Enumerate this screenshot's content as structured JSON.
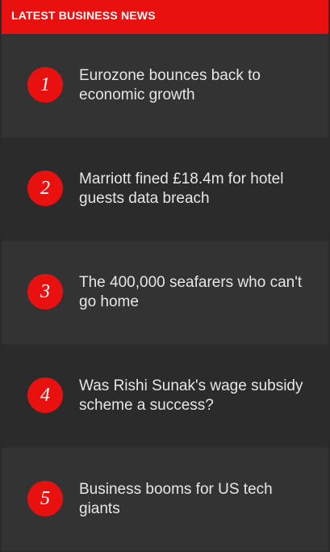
{
  "header": {
    "title": "LATEST BUSINESS NEWS"
  },
  "colors": {
    "accent": "#e8110f",
    "background_odd": "#333333",
    "background_even": "#2b2b2b",
    "text": "#e6e6e6"
  },
  "news": {
    "items": [
      {
        "rank": "1",
        "headline": "Eurozone bounces back to economic growth"
      },
      {
        "rank": "2",
        "headline": "Marriott fined £18.4m for hotel guests data breach"
      },
      {
        "rank": "3",
        "headline": "The 400,000 seafarers who can't go home"
      },
      {
        "rank": "4",
        "headline": "Was Rishi Sunak's wage subsidy scheme a success?"
      },
      {
        "rank": "5",
        "headline": "Business booms for US tech giants"
      }
    ]
  }
}
